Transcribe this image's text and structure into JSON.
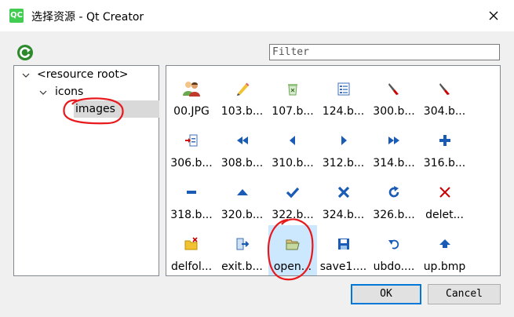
{
  "window": {
    "title": "选择资源 - Qt Creator",
    "logo_text": "QC"
  },
  "filter": {
    "placeholder": "Filter",
    "value": ""
  },
  "tree": {
    "items": [
      {
        "label": "<resource root>"
      },
      {
        "label": "icons"
      },
      {
        "label": "images"
      }
    ]
  },
  "resources": [
    {
      "label": "00.JPG",
      "icon": "people-icon"
    },
    {
      "label": "103.b...",
      "icon": "pencil-icon"
    },
    {
      "label": "107.b...",
      "icon": "recycle-bin-icon"
    },
    {
      "label": "124.b...",
      "icon": "list-icon"
    },
    {
      "label": "300.b...",
      "icon": "brush-icon"
    },
    {
      "label": "304.b...",
      "icon": "brush-icon"
    },
    {
      "label": "306.b...",
      "icon": "import-icon"
    },
    {
      "label": "308.b...",
      "icon": "rewind-icon"
    },
    {
      "label": "310.b...",
      "icon": "arrow-left-icon"
    },
    {
      "label": "312.b...",
      "icon": "arrow-right-icon"
    },
    {
      "label": "314.b...",
      "icon": "fast-forward-icon"
    },
    {
      "label": "316.b...",
      "icon": "plus-icon"
    },
    {
      "label": "318.b...",
      "icon": "minus-icon"
    },
    {
      "label": "320.b...",
      "icon": "arrow-up-icon"
    },
    {
      "label": "322.b...",
      "icon": "checkmark-icon"
    },
    {
      "label": "324.b...",
      "icon": "cross-icon"
    },
    {
      "label": "326.b...",
      "icon": "redo-icon"
    },
    {
      "label": "delet...",
      "icon": "delete-icon"
    },
    {
      "label": "delfol...",
      "icon": "delete-folder-icon"
    },
    {
      "label": "exit.b...",
      "icon": "exit-icon"
    },
    {
      "label": "open...",
      "icon": "open-folder-icon"
    },
    {
      "label": "save1....",
      "icon": "save-icon"
    },
    {
      "label": "ubdo....",
      "icon": "undo-icon"
    },
    {
      "label": "up.bmp",
      "icon": "upload-icon"
    }
  ],
  "buttons": {
    "ok": "OK",
    "cancel": "Cancel"
  }
}
